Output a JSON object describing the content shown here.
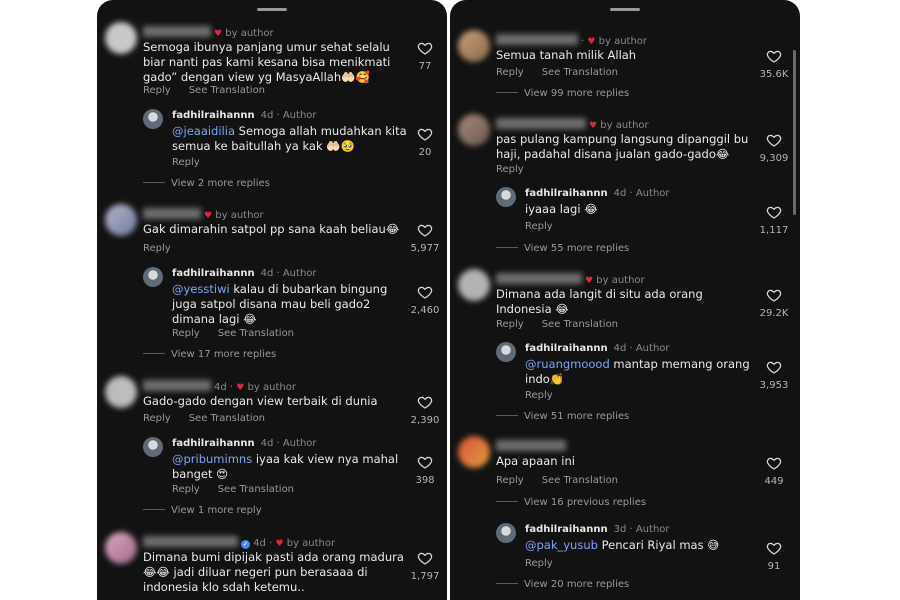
{
  "author_tag": "by author",
  "author_badge": "Author",
  "reply_label": "Reply",
  "see_translation_label": "See Translation",
  "left": {
    "c1": {
      "text": "Semoga ibunya panjang umur sehat selalu biar nanti pas kami kesana bisa menikmati gado” dengan view yg MasyaAllah🤲🏻🥰",
      "likes": "77"
    },
    "r1": {
      "user": "fadhilraihannn",
      "time": "4d",
      "mention": "@jeaaidilia",
      "text": " Semoga allah mudahkan kita semua ke baitullah ya kak 🤲🏻🥹",
      "likes": "20",
      "more": "View 2 more replies"
    },
    "c2": {
      "text": "Gak dimarahin satpol pp sana kaah beliau😂",
      "likes": "5,977"
    },
    "r2": {
      "user": "fadhilraihannn",
      "time": "4d",
      "mention": "@yesstiwi",
      "text": " kalau di bubarkan bingung juga satpol disana mau beli gado2 dimana lagi 😂",
      "likes": "2,460",
      "more": "View 17 more replies"
    },
    "c3": {
      "time": "4d",
      "text": "Gado-gado dengan view terbaik di dunia",
      "likes": "2,390"
    },
    "r3": {
      "user": "fadhilraihannn",
      "time": "4d",
      "mention": "@pribumimns",
      "text": " iyaa kak view nya mahal banget 😍",
      "likes": "398",
      "more": "View 1 more reply"
    },
    "c4": {
      "time": "4d",
      "text": "Dimana bumi dipijak pasti ada orang madura 😂😂 jadi diluar negeri pun berasaaa di indonesia klo sdah ketemu..",
      "likes": "1,797"
    }
  },
  "right": {
    "c1": {
      "text": "Semua tanah milik Allah",
      "likes": "35.6K",
      "more": "View 99 more replies"
    },
    "c2": {
      "text": "pas pulang kampung langsung dipanggil bu haji, padahal disana jualan gado-gado😂",
      "likes": "9,309"
    },
    "r2": {
      "user": "fadhilraihannn",
      "time": "4d",
      "text": "iyaaa lagi 😂",
      "likes": "1,117",
      "more": "View 55 more replies"
    },
    "c3": {
      "text": "Dimana ada langit di situ ada orang Indonesia 😂",
      "likes": "29.2K"
    },
    "r3": {
      "user": "fadhilraihannn",
      "time": "4d",
      "mention": "@ruangmoood",
      "text": " mantap memang orang indo👏",
      "likes": "3,953",
      "more": "View 51 more replies"
    },
    "c4": {
      "text": "Apa apaan ini",
      "likes": "449",
      "more": "View 16 previous replies"
    },
    "r4": {
      "user": "fadhilraihannn",
      "time": "3d",
      "mention": "@pak_yusub",
      "text": " Pencari Riyal mas 😅",
      "likes": "91",
      "more": "View 20 more replies"
    }
  },
  "colors": {
    "panel_bg": "#121212",
    "mention": "#7ea6f2",
    "heart": "#e0243c",
    "verified": "#3a8ef6"
  },
  "icons": {
    "like": "heart-outline-icon",
    "liked_by_author": "heart-filled-icon",
    "verified": "verified-badge-icon"
  }
}
